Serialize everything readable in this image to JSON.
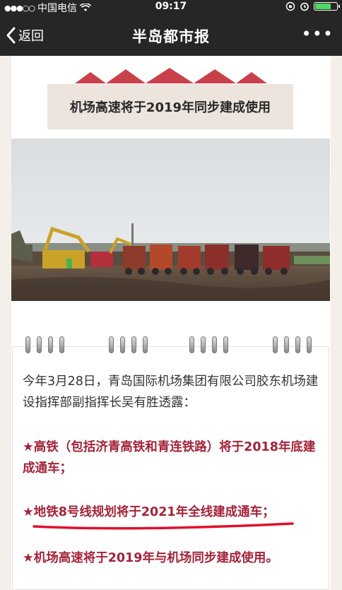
{
  "status_bar": {
    "carrier": "中国电信",
    "time": "09:17"
  },
  "navbar": {
    "back_label": "返回",
    "title": "半岛都市报",
    "more_label": "•••"
  },
  "article": {
    "headline": "机场高速将于2019年同步建成使用",
    "intro": "今年3月28日，青岛国际机场集团有限公司胶东机场建设指挥部副指挥长吴有胜透露：",
    "bullets": [
      "★高铁（包括济青高铁和青连铁路）将于2018年底建成通车；",
      "★地铁8号线规划将于2021年全线建成通车；",
      "★机场高速将于2019年与机场同步建成使用。"
    ]
  },
  "colors": {
    "bar_bg": "#262626",
    "accent_red": "#a3243a",
    "roof_red": "#c8414a",
    "underline_red": "#e0102c",
    "headline_bg": "#ece4dd"
  }
}
